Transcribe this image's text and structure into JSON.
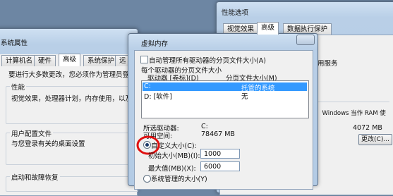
{
  "sys_props": {
    "title": "系统属性",
    "tabs": [
      "计算机名",
      "硬件",
      "高级",
      "系统保护",
      "远"
    ],
    "intro": "要进行大多数更改，您必须作为管理员登录",
    "performance": {
      "group": "性能",
      "desc": "视觉效果，处理器计划，内存使用，以及"
    },
    "user_profile": {
      "group": "用户配置文件",
      "desc": "与您登录有关的桌面设置"
    },
    "startup": {
      "group": "启动和故障恢复"
    }
  },
  "perf_options": {
    "title": "性能选项",
    "tabs": [
      "视觉效果",
      "高级",
      "数据执行保护"
    ],
    "snippet1": "用服务",
    "snippet2": "，Windows 当作 RAM 使",
    "size_value": "4072 MB",
    "change_button": "更改(C)..."
  },
  "virtual_memory": {
    "title": "虚拟内存",
    "auto_manage": "自动管理所有驱动器的分页文件大小(A)",
    "section_label": "每个驱动器的分页文件大小",
    "col_drive": "驱动器 [卷标](D)",
    "col_size": "分页文件大小(M)",
    "drives": [
      {
        "drive": "C:",
        "size": "托管的系统"
      },
      {
        "drive": "D:   [软件]",
        "size": "无"
      }
    ],
    "selected_drive_label": "所选驱动器:",
    "selected_drive_value": "C:",
    "free_space_label": "可用空间:",
    "free_space_value": "78467 MB",
    "custom_size": "自定义大小(C):",
    "initial_label": "初始大小(MB)(I):",
    "initial_value": "1000",
    "max_label": "最大值(MB)(X):",
    "max_value": "6000",
    "system_managed": "系统管理的大小(Y)"
  },
  "colors": {
    "highlight": "#3399ff",
    "annotation": "#e01010"
  }
}
